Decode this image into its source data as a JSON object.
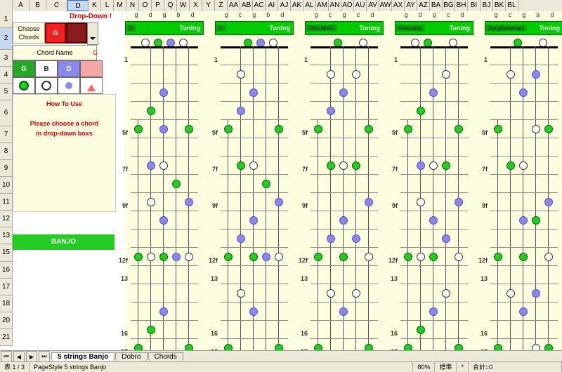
{
  "columns": [
    "",
    "A",
    "B",
    "C",
    "D",
    "K",
    "L",
    "M",
    "N",
    "O",
    "P",
    "Q",
    "W",
    "X",
    "Y",
    "Z",
    "AA",
    "AB",
    "AC",
    "AI",
    "AJ",
    "AK",
    "AL",
    "AM",
    "AN",
    "AO",
    "AU",
    "AV",
    "AW",
    "AX",
    "AY",
    "AZ",
    "BA",
    "BG",
    "BH",
    "BI",
    "BJ",
    "BK",
    "BL"
  ],
  "active_col": "D",
  "rows": [
    "1",
    "2",
    "3",
    "4",
    "5",
    "6",
    "7",
    "8",
    "9",
    "10",
    "11",
    "12",
    "13",
    "15",
    "16",
    "17",
    "18",
    "20",
    "21"
  ],
  "active_row": "2",
  "dropdown_label": "Drop-Down !",
  "choose_label": "Choose Chords",
  "picked_chord": "G",
  "chordname_label": "Chord Name",
  "chordname_value": "G",
  "chips": [
    "G",
    "B",
    "D",
    ""
  ],
  "howto_title": "How To Use",
  "howto_text1": "Please choose a chord",
  "howto_text2": "in drop-down boxs",
  "banjo_label": "BANJO",
  "tunings": [
    {
      "name": "G",
      "label": "Tuning",
      "open": [
        "g",
        "d",
        "g",
        "b",
        "d"
      ]
    },
    {
      "name": "C",
      "label": "Tuning",
      "open": [
        "g",
        "c",
        "g",
        "b",
        "d"
      ]
    },
    {
      "name": "DoubleC",
      "label": "Tuning",
      "open": [
        "g",
        "c",
        "g",
        "c",
        "d"
      ]
    },
    {
      "name": "Gmodal",
      "label": "Tuning",
      "open": [
        "g",
        "d",
        "g",
        "c",
        "d"
      ]
    },
    {
      "name": "Englishman",
      "label": "Tuning",
      "open": [
        "g",
        "c",
        "g",
        "a",
        "d"
      ]
    }
  ],
  "fret_markers": [
    "1",
    "",
    "",
    "",
    "5f",
    "",
    "7f",
    "",
    "9f",
    "",
    "",
    "12f",
    "13",
    "",
    "",
    "16",
    "17"
  ],
  "tabs": [
    "5 strings Banjo",
    "Dobro",
    "Chords"
  ],
  "active_tab": 0,
  "status": {
    "left": "表 1 / 3",
    "mid": "PageStyle 5 strings Banjo",
    "zoom": "80%",
    "mode": "標準",
    "star": "*",
    "sum": "合計=0"
  },
  "chart_data": {
    "type": "table",
    "note": "Fretboard dot positions per tuning; string index 0..4 left→right, fret 0=open",
    "tunings": {
      "G": {
        "open": [
          null,
          "w",
          "g",
          "b",
          "w"
        ],
        "frets": {
          "3": [
            {
              "s": 2,
              "c": "b"
            }
          ],
          "4": [
            {
              "s": 1,
              "c": "g"
            }
          ],
          "5": [
            {
              "s": 0,
              "c": "g"
            },
            {
              "s": 2,
              "c": "b"
            },
            {
              "s": 4,
              "c": "g"
            }
          ],
          "7": [
            {
              "s": 1,
              "c": "b"
            },
            {
              "s": 2,
              "c": "w"
            }
          ],
          "8": [
            {
              "s": 3,
              "c": "g"
            }
          ],
          "9": [
            {
              "s": 1,
              "c": "w"
            },
            {
              "s": 4,
              "c": "b"
            }
          ],
          "10": [
            {
              "s": 2,
              "c": "b"
            }
          ],
          "12": [
            {
              "s": 0,
              "c": "g"
            },
            {
              "s": 1,
              "c": "w"
            },
            {
              "s": 2,
              "c": "g"
            },
            {
              "s": 3,
              "c": "b"
            },
            {
              "s": 4,
              "c": "w"
            }
          ],
          "15": [
            {
              "s": 2,
              "c": "b"
            }
          ],
          "16": [
            {
              "s": 1,
              "c": "g"
            }
          ],
          "17": [
            {
              "s": 0,
              "c": "g"
            },
            {
              "s": 4,
              "c": "g"
            }
          ]
        }
      },
      "C": {
        "open": [
          null,
          null,
          "g",
          "b",
          "w"
        ],
        "frets": {
          "2": [
            {
              "s": 1,
              "c": "w"
            }
          ],
          "3": [
            {
              "s": 2,
              "c": "b"
            }
          ],
          "4": [
            {
              "s": 1,
              "c": "b"
            }
          ],
          "5": [
            {
              "s": 0,
              "c": "g"
            },
            {
              "s": 4,
              "c": "g"
            }
          ],
          "7": [
            {
              "s": 1,
              "c": "g"
            },
            {
              "s": 2,
              "c": "w"
            }
          ],
          "8": [
            {
              "s": 3,
              "c": "g"
            }
          ],
          "9": [
            {
              "s": 4,
              "c": "b"
            }
          ],
          "10": [
            {
              "s": 2,
              "c": "b"
            }
          ],
          "11": [
            {
              "s": 1,
              "c": "b"
            }
          ],
          "12": [
            {
              "s": 0,
              "c": "g"
            },
            {
              "s": 2,
              "c": "g"
            },
            {
              "s": 3,
              "c": "b"
            },
            {
              "s": 4,
              "c": "w"
            }
          ],
          "14": [
            {
              "s": 1,
              "c": "w"
            }
          ],
          "15": [
            {
              "s": 2,
              "c": "b"
            }
          ],
          "17": [
            {
              "s": 0,
              "c": "g"
            },
            {
              "s": 4,
              "c": "g"
            }
          ]
        }
      },
      "DoubleC": {
        "open": [
          null,
          null,
          "g",
          null,
          "w"
        ],
        "frets": {
          "2": [
            {
              "s": 1,
              "c": "w"
            },
            {
              "s": 3,
              "c": "w"
            }
          ],
          "3": [
            {
              "s": 2,
              "c": "b"
            }
          ],
          "4": [
            {
              "s": 1,
              "c": "b"
            }
          ],
          "5": [
            {
              "s": 0,
              "c": "g"
            },
            {
              "s": 4,
              "c": "g"
            }
          ],
          "7": [
            {
              "s": 1,
              "c": "g"
            },
            {
              "s": 2,
              "c": "w"
            },
            {
              "s": 3,
              "c": "g"
            }
          ],
          "9": [
            {
              "s": 4,
              "c": "b"
            }
          ],
          "10": [
            {
              "s": 2,
              "c": "b"
            }
          ],
          "11": [
            {
              "s": 1,
              "c": "b"
            },
            {
              "s": 3,
              "c": "b"
            }
          ],
          "12": [
            {
              "s": 0,
              "c": "g"
            },
            {
              "s": 2,
              "c": "g"
            },
            {
              "s": 4,
              "c": "w"
            }
          ],
          "14": [
            {
              "s": 1,
              "c": "w"
            },
            {
              "s": 3,
              "c": "w"
            }
          ],
          "15": [
            {
              "s": 2,
              "c": "b"
            }
          ],
          "17": [
            {
              "s": 0,
              "c": "g"
            },
            {
              "s": 4,
              "c": "g"
            }
          ]
        }
      },
      "Gmodal": {
        "open": [
          null,
          "w",
          "g",
          null,
          "w"
        ],
        "frets": {
          "2": [
            {
              "s": 3,
              "c": "w"
            }
          ],
          "3": [
            {
              "s": 2,
              "c": "b"
            }
          ],
          "4": [
            {
              "s": 1,
              "c": "g"
            }
          ],
          "5": [
            {
              "s": 0,
              "c": "g"
            },
            {
              "s": 4,
              "c": "g"
            }
          ],
          "7": [
            {
              "s": 1,
              "c": "b"
            },
            {
              "s": 2,
              "c": "w"
            },
            {
              "s": 3,
              "c": "g"
            }
          ],
          "9": [
            {
              "s": 1,
              "c": "w"
            },
            {
              "s": 4,
              "c": "b"
            }
          ],
          "10": [
            {
              "s": 2,
              "c": "b"
            }
          ],
          "11": [
            {
              "s": 3,
              "c": "b"
            }
          ],
          "12": [
            {
              "s": 0,
              "c": "g"
            },
            {
              "s": 1,
              "c": "w"
            },
            {
              "s": 2,
              "c": "g"
            },
            {
              "s": 4,
              "c": "w"
            }
          ],
          "14": [
            {
              "s": 3,
              "c": "w"
            }
          ],
          "15": [
            {
              "s": 2,
              "c": "b"
            }
          ],
          "16": [
            {
              "s": 1,
              "c": "g"
            }
          ],
          "17": [
            {
              "s": 0,
              "c": "g"
            },
            {
              "s": 4,
              "c": "g"
            }
          ]
        }
      },
      "Englishman": {
        "open": [
          null,
          null,
          "g",
          null,
          "w"
        ],
        "frets": {
          "2": [
            {
              "s": 1,
              "c": "w"
            },
            {
              "s": 3,
              "c": "b"
            }
          ],
          "3": [
            {
              "s": 2,
              "c": "b"
            }
          ],
          "5": [
            {
              "s": 0,
              "c": "g"
            },
            {
              "s": 3,
              "c": "w"
            },
            {
              "s": 4,
              "c": "g"
            }
          ],
          "7": [
            {
              "s": 1,
              "c": "g"
            },
            {
              "s": 2,
              "c": "w"
            }
          ],
          "9": [
            {
              "s": 4,
              "c": "b"
            }
          ],
          "10": [
            {
              "s": 2,
              "c": "b"
            },
            {
              "s": 3,
              "c": "g"
            }
          ],
          "12": [
            {
              "s": 0,
              "c": "g"
            },
            {
              "s": 2,
              "c": "g"
            },
            {
              "s": 4,
              "c": "w"
            }
          ],
          "14": [
            {
              "s": 1,
              "c": "w"
            },
            {
              "s": 3,
              "c": "b"
            }
          ],
          "15": [
            {
              "s": 2,
              "c": "b"
            }
          ],
          "17": [
            {
              "s": 0,
              "c": "g"
            },
            {
              "s": 3,
              "c": "w"
            },
            {
              "s": 4,
              "c": "g"
            }
          ]
        }
      }
    }
  }
}
